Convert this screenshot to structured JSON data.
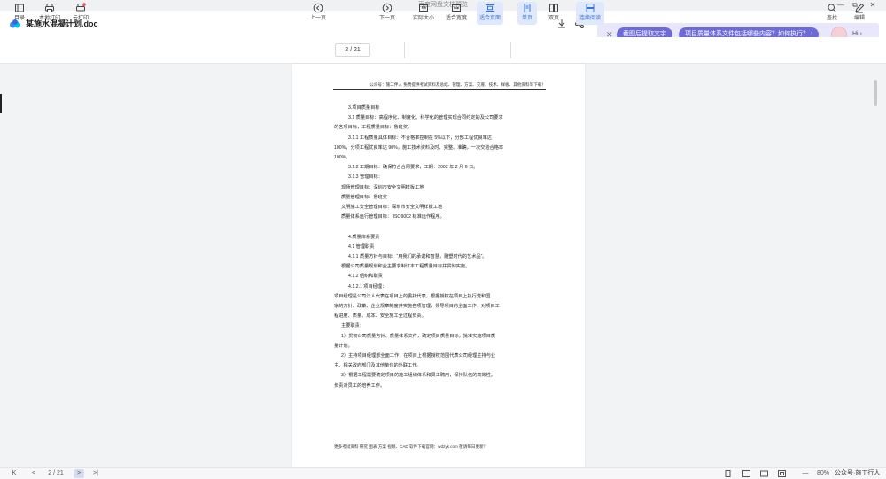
{
  "window": {
    "title": "百度网盘文档预览",
    "controls": [
      "—",
      "⧉",
      "✕"
    ]
  },
  "doc": {
    "name": "某施水混凝计划.doc"
  },
  "ai": {
    "suggestion_1": "截图后提取文字",
    "suggestion_2": "项目质量体系文件包括哪些内容？如何执行？",
    "greeting": "Hi",
    "chevron": "›"
  },
  "toolbar": {
    "left": [
      {
        "label": "目录",
        "icon": "toc-icon"
      },
      {
        "label": "本地打印",
        "icon": "printer-icon"
      },
      {
        "label": "云打印",
        "icon": "cloud-print-icon"
      }
    ],
    "prev_label": "上一页",
    "page_indicator": "2 / 21",
    "next_label": "下一页",
    "view_modes": [
      {
        "label": "实际大小",
        "icon": "actual-size-icon",
        "active": false
      },
      {
        "label": "适合宽度",
        "icon": "fit-width-icon",
        "active": false
      },
      {
        "label": "适合页面",
        "icon": "fit-page-icon",
        "active": true
      }
    ],
    "page_modes": [
      {
        "label": "单页",
        "icon": "single-page-icon",
        "active": true
      },
      {
        "label": "双页",
        "icon": "double-page-icon",
        "active": false
      },
      {
        "label": "连续阅读",
        "icon": "continuous-icon",
        "active": true
      }
    ],
    "right": [
      {
        "label": "查找",
        "icon": "search-icon"
      },
      {
        "label": "编辑",
        "icon": "edit-icon"
      }
    ]
  },
  "page": {
    "header": "公众号：施工伴人 免费提供考试资料及总结、管理、方案、交底、技术、样板、其他资料等下载！",
    "lines": [
      {
        "text": "3.项目质量目标",
        "indent": 2
      },
      {
        "text": "3.1 质量目标：高程序化、制度化、科学化的管理实现合同约定的及公司要求",
        "indent": 2
      },
      {
        "text": "的各项目标，工程质量目标：鲁班奖。",
        "indent": 0
      },
      {
        "text": "3.1.1 工程质量具体目标：不合格率控制在 5%以下，分部工程优良率达",
        "indent": 2
      },
      {
        "text": "100%，分项工程优良率达 90%，施工技术资料及时、完整、准确，一次交验合格率",
        "indent": 0
      },
      {
        "text": "100%。",
        "indent": 0
      },
      {
        "text": "3.1.2 工期目标：确保符合合同要求，工期：2002 年 2 月 6 日。",
        "indent": 2
      },
      {
        "text": "3.1.3 管理目标：",
        "indent": 2
      },
      {
        "text": "现场管理目标：深圳市安全文明样板工地",
        "indent": 1
      },
      {
        "text": "质量管理目标：鲁班奖",
        "indent": 1
      },
      {
        "text": "文明施工安全管理目标：深圳市安全文明样板工地",
        "indent": 1
      },
      {
        "text": "质量体系运行管理目标：  ISO9002 标准运作程序。",
        "indent": 1
      },
      {
        "text": "",
        "indent": 0
      },
      {
        "text": "4.质量体系要素",
        "indent": 2
      },
      {
        "text": "4.1 管理职责",
        "indent": 2
      },
      {
        "text": "4.1.1 质量方针与目标：“用我们的承诺和智慧，雕塑时代的艺术品”。",
        "indent": 2
      },
      {
        "text": "根据公司质量规划和业主要求制订本工程质量目标并贯彻实施。",
        "indent": 1
      },
      {
        "text": "4.1.2 组织和职责",
        "indent": 2
      },
      {
        "text": "4.1.2.1 项目经理：",
        "indent": 2
      },
      {
        "text": "项目经理是公司法人代表在项目上的委托代表，根据授权在项目上执行党和国",
        "indent": 0
      },
      {
        "text": "家的方针、政策、企业规章制度并实施各项管理，领导项目的全面工作，对项目工",
        "indent": 0
      },
      {
        "text": "程进度、质量、成本、安全施工全过程负责。",
        "indent": 0
      },
      {
        "text": "主要职责：",
        "indent": 1
      },
      {
        "text": "1）贯彻公司质量方针、质量体系文件，确定项目质量目标，批准实施项目质",
        "indent": 1
      },
      {
        "text": "量计划。",
        "indent": 0
      },
      {
        "text": "2）主持项目经理部全面工作，在项目上根据授权范围代表公司经理主持与业",
        "indent": 1
      },
      {
        "text": "主、相关政府部门及其他单位的外联工作。",
        "indent": 0
      },
      {
        "text": "3）根据工程需要确定项目的施工组织体系和员工聘用，保持队伍的高效性。",
        "indent": 1
      },
      {
        "text": "负责对员工的培养工作。",
        "indent": 0
      }
    ],
    "footer": "更多考试资料 研究 图表 方案 视频、CAD 软件下载官网：wdzyk.com 敬请每日更新！"
  },
  "statusbar": {
    "first": "K",
    "prev": "<",
    "page": "2 / 21",
    "next": ">",
    "last": ">|",
    "zoom_minus": "—",
    "zoom_plus": "+",
    "zoom_level": "80%",
    "zoom_fraction": 0.55,
    "watermark": "公众号·施工行人"
  }
}
